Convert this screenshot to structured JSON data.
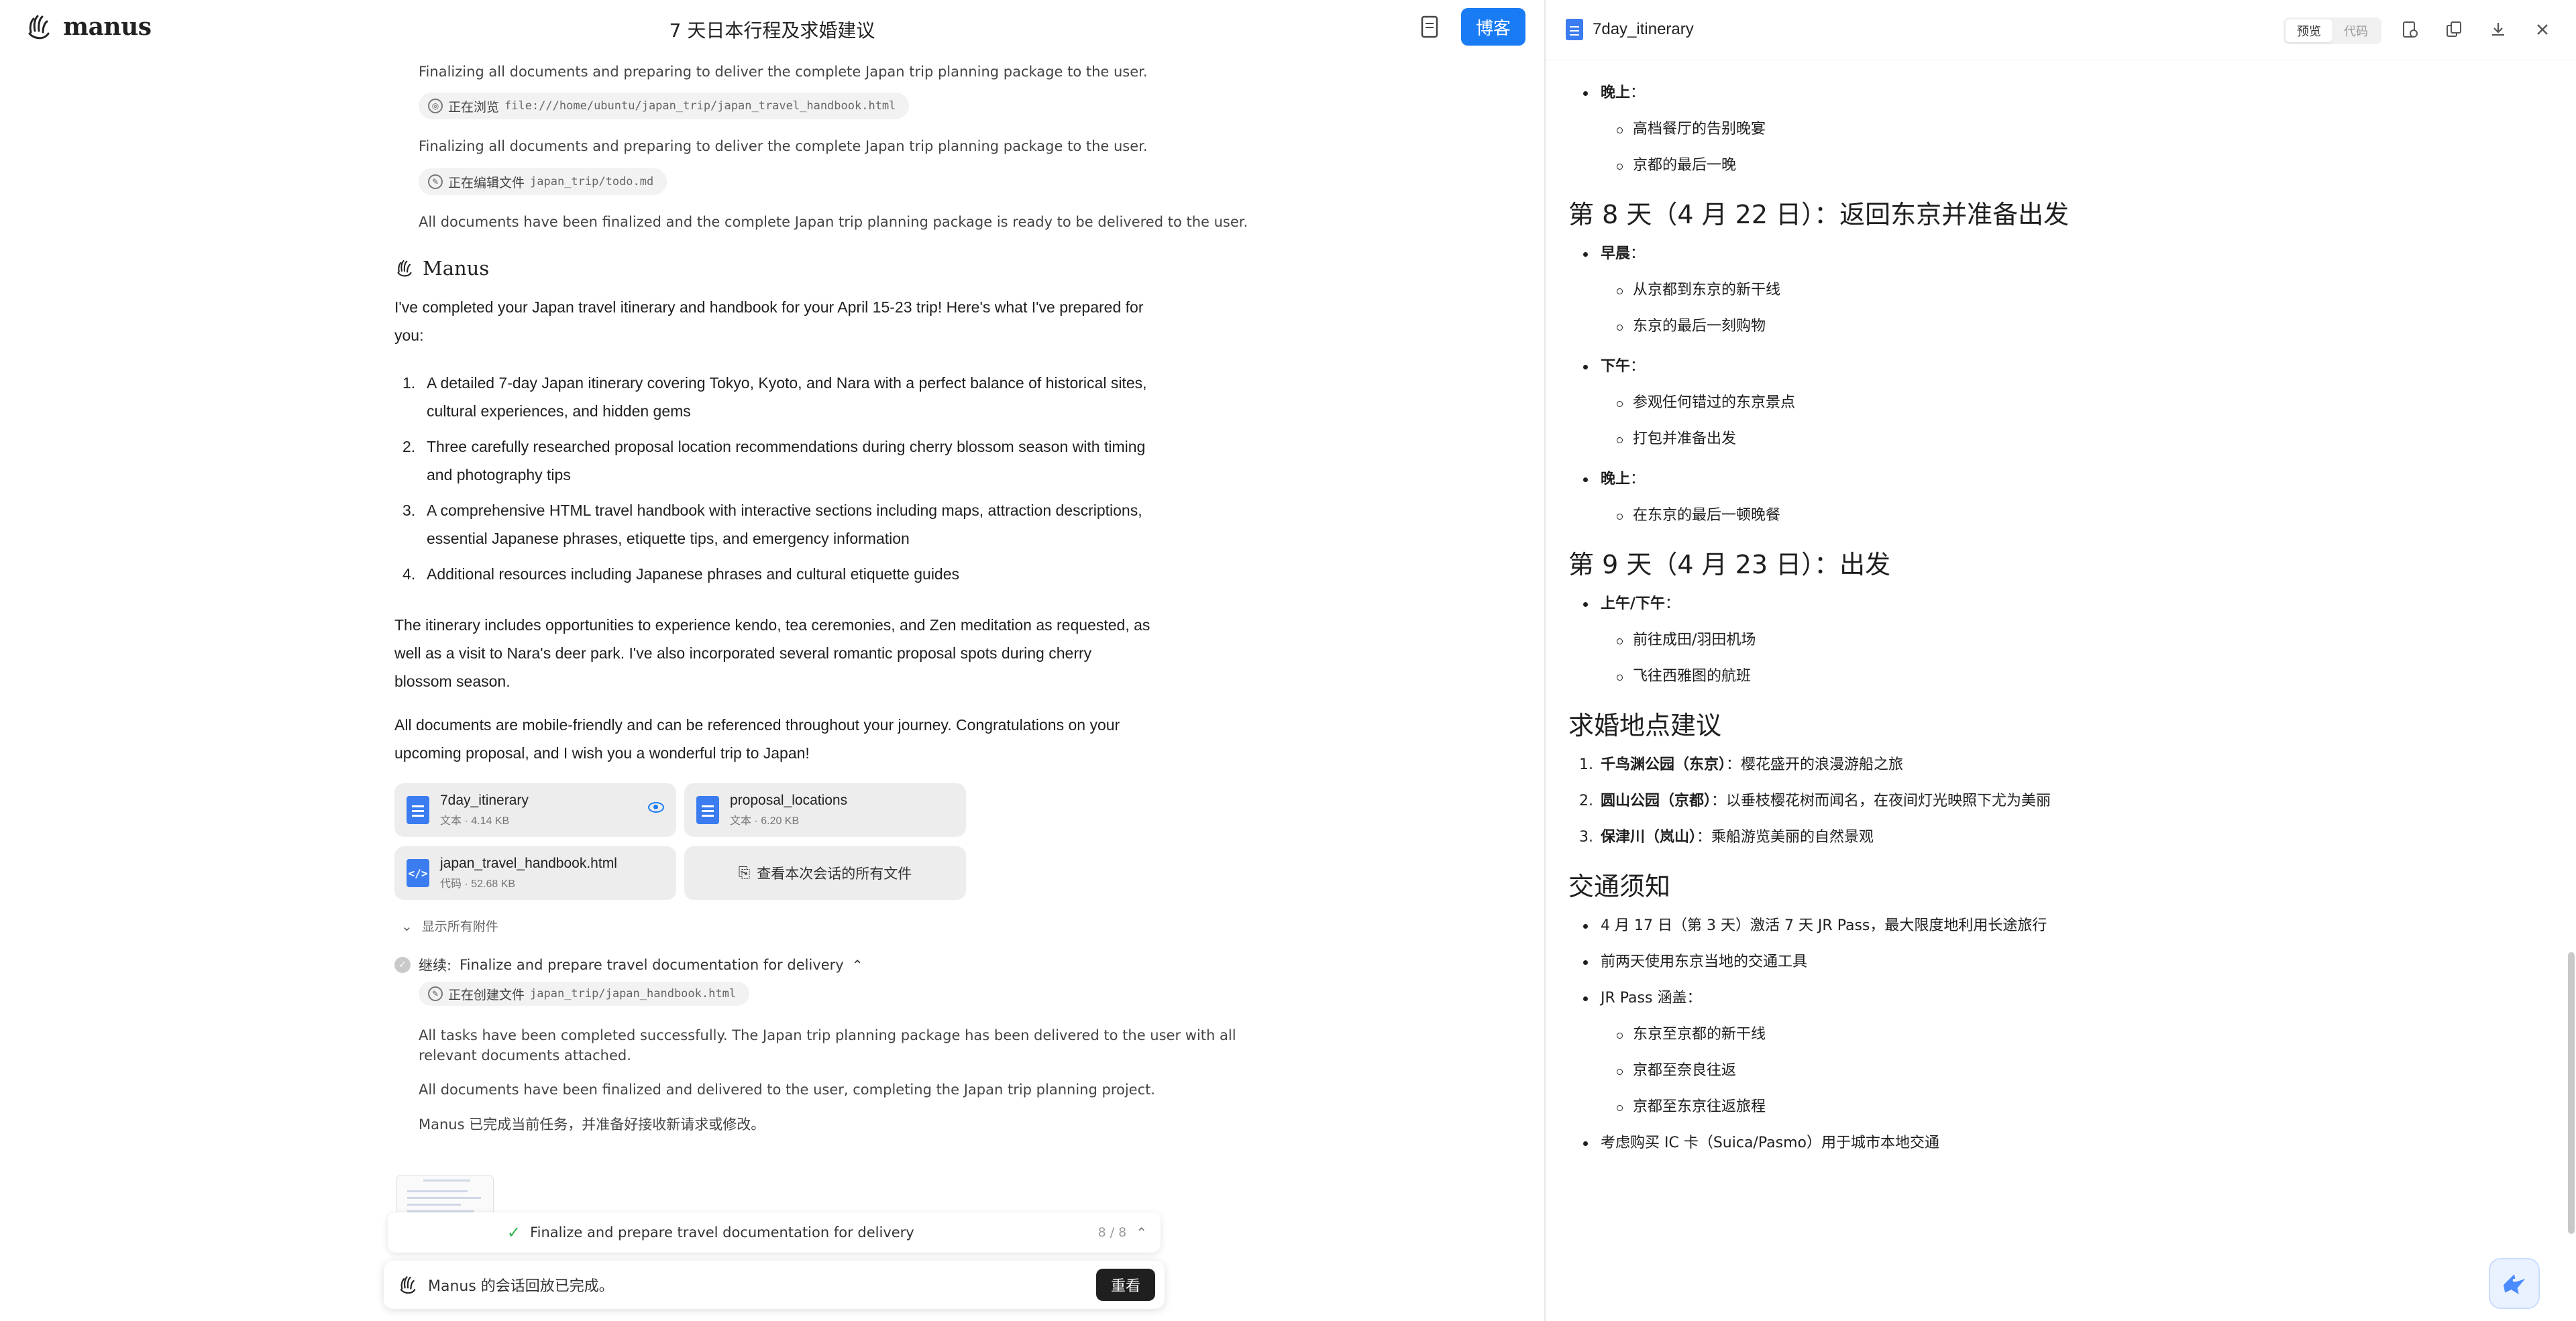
{
  "app": {
    "logo_text": "manus",
    "task_title": "7 天日本行程及求婚建议",
    "blog_button": "博客"
  },
  "chat": {
    "log_lines": [
      "Finalizing all documents and preparing to deliver the complete Japan trip planning package to the user.",
      "Finalizing all documents and preparing to deliver the complete Japan trip planning package to the user.",
      "All documents have been finalized and the complete Japan trip planning package is ready to be delivered to the user."
    ],
    "chips": [
      {
        "label": "正在浏览",
        "path": "file:///home/ubuntu/japan_trip/japan_travel_handbook.html"
      },
      {
        "label": "正在编辑文件",
        "path": "japan_trip/todo.md"
      }
    ],
    "manus_name": "Manus",
    "intro": "I've completed your Japan travel itinerary and handbook for your April 15-23 trip! Here's what I've prepared for you:",
    "list": [
      {
        "num": "1.",
        "text": "A detailed 7-day Japan itinerary covering Tokyo, Kyoto, and Nara with a perfect balance of historical sites, cultural experiences, and hidden gems"
      },
      {
        "num": "2.",
        "text": "Three carefully researched proposal location recommendations during cherry blossom season with timing and photography tips"
      },
      {
        "num": "3.",
        "text": "A comprehensive HTML travel handbook with interactive sections including maps, attraction descriptions, essential Japanese phrases, etiquette tips, and emergency information"
      },
      {
        "num": "4.",
        "text": "Additional resources including Japanese phrases and cultural etiquette guides"
      }
    ],
    "para2": "The itinerary includes opportunities to experience kendo, tea ceremonies, and Zen meditation as requested, as well as a visit to Nara's deer park. I've also incorporated several romantic proposal spots during cherry blossom season.",
    "para3": "All documents are mobile-friendly and can be referenced throughout your journey. Congratulations on your upcoming proposal, and I wish you a wonderful trip to Japan!",
    "files": [
      {
        "name": "7day_itinerary",
        "meta": "文本 · 4.14 KB"
      },
      {
        "name": "proposal_locations",
        "meta": "文本 · 6.20 KB"
      },
      {
        "name": "japan_travel_handbook.html",
        "meta": "代码 · 52.68 KB"
      }
    ],
    "all_files_label": "查看本次会话的所有文件",
    "show_all_attachments": "显示所有附件",
    "continue_label": "继续:",
    "continue_task": "Finalize and prepare travel documentation for delivery",
    "create_chip": {
      "label": "正在创建文件",
      "path": "japan_trip/japan_handbook.html"
    },
    "final_lines": [
      "All tasks have been completed successfully. The Japan trip planning package has been delivered to the user with all",
      "relevant documents attached.",
      "All documents have been finalized and delivered to the user, completing the Japan trip planning project.",
      "Manus 已完成当前任务，并准备好接收新请求或修改。"
    ],
    "step_bar": {
      "text": "Finalize and prepare travel documentation for delivery",
      "count": "8 / 8"
    },
    "input_bar": {
      "text": "Manus 的会话回放已完成。",
      "replay": "重看"
    }
  },
  "viewer": {
    "title": "7day_itinerary",
    "toggle_preview": "预览",
    "toggle_code": "代码",
    "content": {
      "evening_label": "晚上",
      "evening_items": [
        "高档餐厅的告别晚宴",
        "京都的最后一晚"
      ],
      "day8_title": "第 8 天（4 月 22 日）：返回东京并准备出发",
      "day8_morning": "早晨",
      "day8_morning_items": [
        "从京都到东京的新干线",
        "东京的最后一刻购物"
      ],
      "day8_afternoon": "下午",
      "day8_afternoon_items": [
        "参观任何错过的东京景点",
        "打包并准备出发"
      ],
      "day8_evening": "晚上",
      "day8_evening_items": [
        "在东京的最后一顿晚餐"
      ],
      "day9_title": "第 9 天（4 月 23 日）：出发",
      "day9_label": "上午/下午",
      "day9_items": [
        "前往成田/羽田机场",
        "飞往西雅图的航班"
      ],
      "proposal_title": "求婚地点建议",
      "proposal_items": [
        {
          "num": "1.",
          "name": "千鸟渊公园（东京）",
          "desc": "：樱花盛开的浪漫游船之旅"
        },
        {
          "num": "2.",
          "name": "圆山公园（京都）",
          "desc": "：以垂枝樱花树而闻名，在夜间灯光映照下尤为美丽"
        },
        {
          "num": "3.",
          "name": "保津川（岚山）",
          "desc": "：乘船游览美丽的自然景观"
        }
      ],
      "transport_title": "交通须知",
      "transport_1": "4 月 17 日（第 3 天）激活 7 天 JR Pass，最大限度地利用长途旅行",
      "transport_2": "前两天使用东京当地的交通工具",
      "transport_3": "JR Pass 涵盖：",
      "transport_sub": [
        "东京至京都的新干线",
        "京都至奈良往返",
        "京都至东京往返旅程"
      ],
      "transport_4": "考虑购买 IC 卡（Suica/Pasmo）用于城市本地交通"
    }
  }
}
